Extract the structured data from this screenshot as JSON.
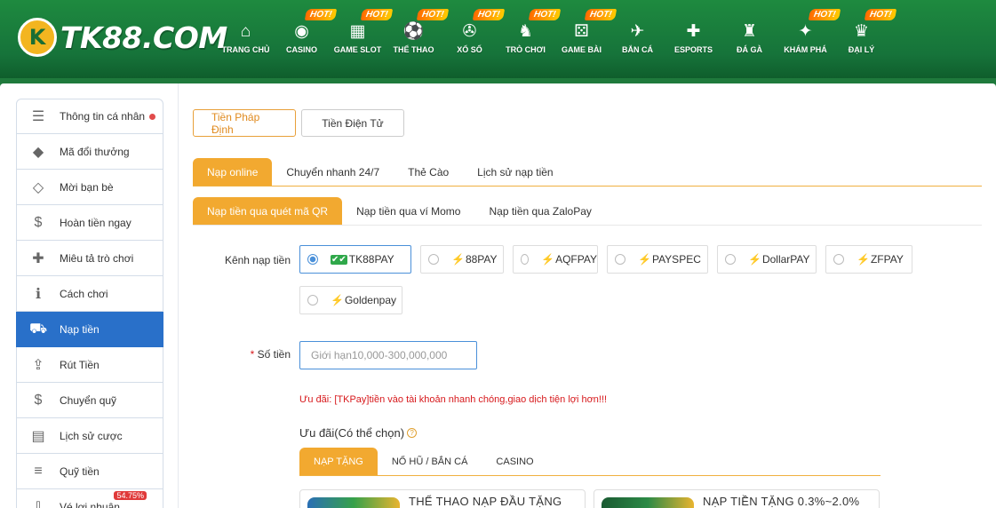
{
  "header": {
    "logo_mark": "K",
    "logo_text": "TK88.COM",
    "hot_label": "HOT!",
    "nav": [
      {
        "label": "TRANG CHỦ",
        "icon": "home-icon",
        "glyph": "⌂",
        "hot": false
      },
      {
        "label": "CASINO",
        "icon": "casino-chip-icon",
        "glyph": "◉",
        "hot": true
      },
      {
        "label": "GAME SLOT",
        "icon": "slot-machine-icon",
        "glyph": "▦",
        "hot": true
      },
      {
        "label": "THỂ THAO",
        "icon": "soccer-ball-icon",
        "glyph": "⚽",
        "hot": true
      },
      {
        "label": "XỔ SỐ",
        "icon": "lottery-ball-icon",
        "glyph": "✇",
        "hot": true
      },
      {
        "label": "TRÒ CHƠI",
        "icon": "chess-knight-icon",
        "glyph": "♞",
        "hot": true
      },
      {
        "label": "GAME BÀI",
        "icon": "dice-icon",
        "glyph": "⚄",
        "hot": true
      },
      {
        "label": "BẮN CÁ",
        "icon": "fish-icon",
        "glyph": "✈",
        "hot": false
      },
      {
        "label": "ESPORTS",
        "icon": "gamepad-icon",
        "glyph": "✚",
        "hot": false
      },
      {
        "label": "ĐÁ GÀ",
        "icon": "rooster-icon",
        "glyph": "♜",
        "hot": false
      },
      {
        "label": "KHÁM PHÁ",
        "icon": "gift-icon",
        "glyph": "✦",
        "hot": true
      },
      {
        "label": "ĐẠI LÝ",
        "icon": "agent-icon",
        "glyph": "♛",
        "hot": true
      }
    ]
  },
  "sidebar": {
    "items": [
      {
        "label": "Thông tin cá nhân",
        "icon": "profile-card-icon",
        "glyph": "☰",
        "dot": true
      },
      {
        "label": "Mã đổi thưởng",
        "icon": "tag-icon",
        "glyph": "◆"
      },
      {
        "label": "Mời bạn bè",
        "icon": "diamond-icon",
        "glyph": "◇"
      },
      {
        "label": "Hoàn tiền ngay",
        "icon": "cashback-icon",
        "glyph": "$"
      },
      {
        "label": "Miêu tả trò chơi",
        "icon": "gamepad-icon",
        "glyph": "✚"
      },
      {
        "label": "Cách chơi",
        "icon": "info-icon",
        "glyph": "ℹ"
      },
      {
        "label": "Nạp tiền",
        "icon": "deposit-icon",
        "glyph": "⛟",
        "active": true
      },
      {
        "label": "Rút Tiền",
        "icon": "withdraw-icon",
        "glyph": "⇪"
      },
      {
        "label": "Chuyển quỹ",
        "icon": "transfer-icon",
        "glyph": "$"
      },
      {
        "label": "Lịch sử cược",
        "icon": "history-icon",
        "glyph": "▤"
      },
      {
        "label": "Quỹ tiền",
        "icon": "coins-icon",
        "glyph": "≡"
      },
      {
        "label": "Vé lợi nhuận",
        "icon": "ticket-icon",
        "glyph": "⇩",
        "badge": "54.75%"
      }
    ]
  },
  "currency_tabs": [
    "Tiền Pháp Định",
    "Tiền Điện Tử"
  ],
  "deposit_tabs": [
    "Nạp online",
    "Chuyển nhanh 24/7",
    "Thẻ Cào",
    "Lịch sử nạp tiền"
  ],
  "method_tabs": [
    "Nạp tiền qua quét mã QR",
    "Nạp tiền qua ví Momo",
    "Nạp tiền qua ZaloPay"
  ],
  "form": {
    "channel_label": "Kênh nạp tiền",
    "amount_label": "Số tiền",
    "required_mark": "*",
    "amount_placeholder": "Giới hạn10,000-300,000,000",
    "amount_value": ""
  },
  "channels": [
    {
      "name": "TK88PAY",
      "selected": true,
      "prefix": "checks"
    },
    {
      "name": "88PAY",
      "selected": false,
      "prefix": "bolt"
    },
    {
      "name": "AQFPAY",
      "selected": false,
      "prefix": "bolt"
    },
    {
      "name": "PAYSPEC",
      "selected": false,
      "prefix": "bolt"
    },
    {
      "name": "DollarPAY",
      "selected": false,
      "prefix": "bolt"
    },
    {
      "name": "ZFPAY",
      "selected": false,
      "prefix": "bolt"
    },
    {
      "name": "Goldenpay",
      "selected": false,
      "prefix": "bolt"
    }
  ],
  "promo": {
    "note": "Ưu đãi:  [TKPay]tiền vào tài khoản nhanh chóng,giao dịch tiện lợi hơn!!!",
    "title": "Ưu đãi(Có thể chọn)",
    "help_glyph": "?",
    "tabs": [
      "NẠP TẶNG",
      "NỔ HŨ / BẮN CÁ",
      "CASINO"
    ],
    "cards": [
      "THỂ THAO NẠP ĐẦU TẶNG",
      "NẠP TIỀN TẶNG 0.3%~2.0%"
    ]
  },
  "colors": {
    "brand_green": "#1e8a3f",
    "accent_orange": "#f2a930",
    "active_blue": "#2970c9",
    "warning_red": "#d7191c"
  }
}
